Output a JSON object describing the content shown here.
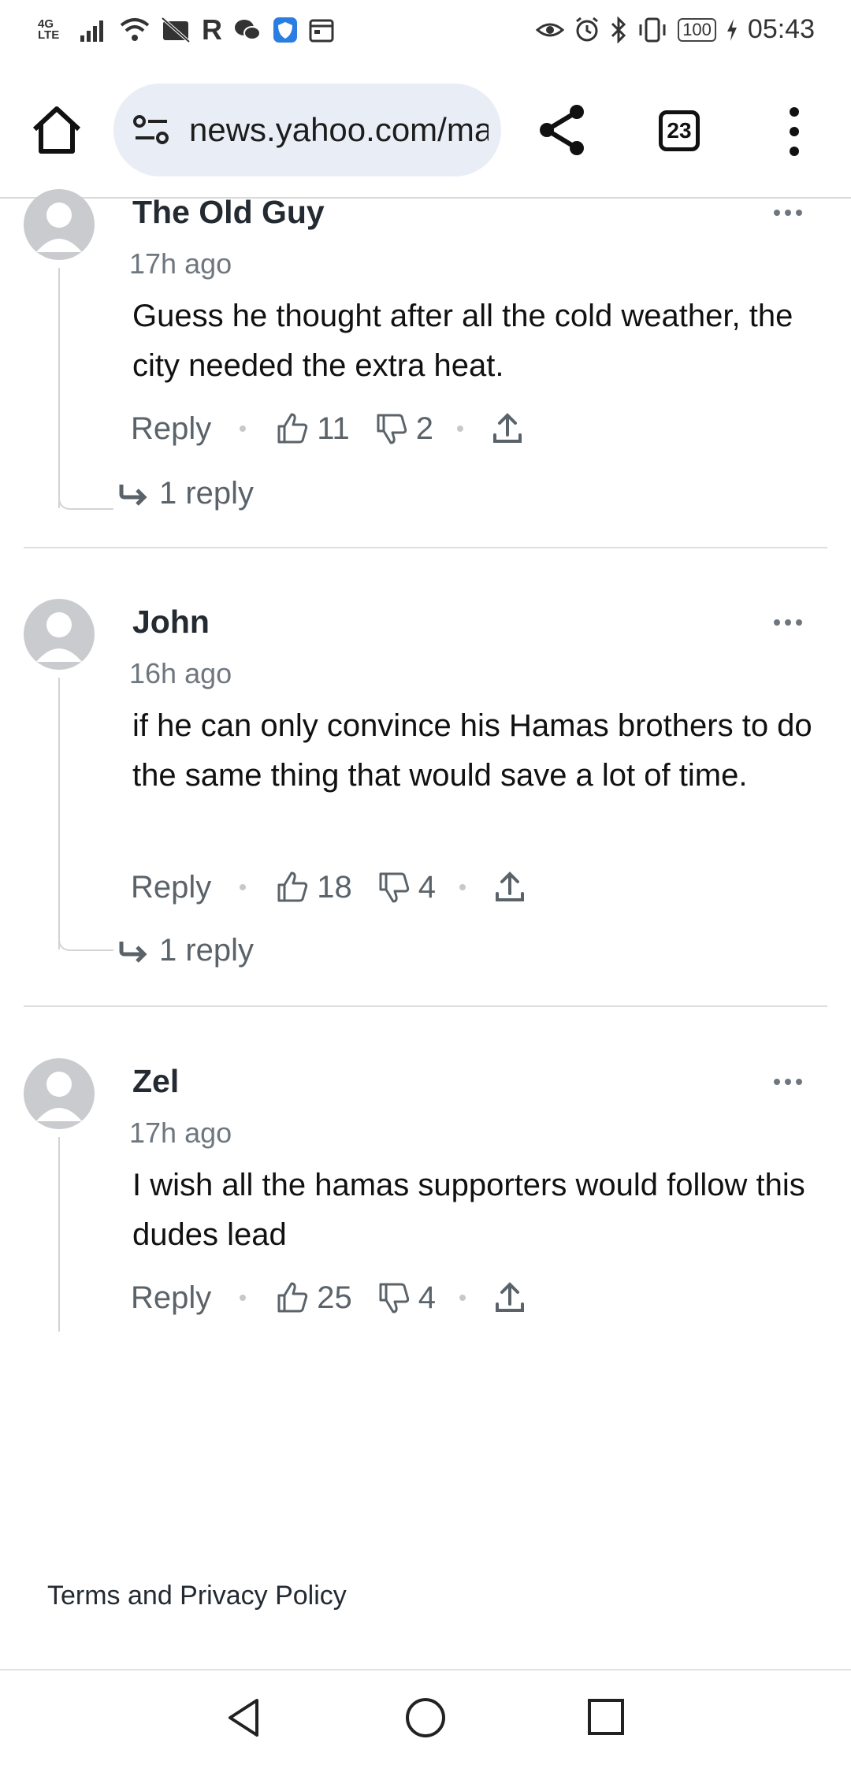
{
  "status_bar": {
    "network": "4G LTE",
    "battery": "100",
    "time": "05:43"
  },
  "browser": {
    "url": "news.yahoo.com/ma",
    "tab_count": "23",
    "icons": [
      "home-icon",
      "site-settings-icon",
      "share-icon",
      "tabs-icon",
      "more-vert-icon"
    ]
  },
  "comments": [
    {
      "author": "The Old Guy",
      "time": "17h ago",
      "text": "Guess he thought after all the cold weather, the city needed the extra heat.",
      "reply_label": "Reply",
      "likes": "11",
      "dislikes": "2",
      "replies": "1 reply"
    },
    {
      "author": "John",
      "time": "16h ago",
      "text": "if he can only convince his Hamas brothers to do the same thing that would save a lot of time.",
      "reply_label": "Reply",
      "likes": "18",
      "dislikes": "4",
      "replies": "1 reply"
    },
    {
      "author": "Zel",
      "time": "17h ago",
      "text": "I wish all the hamas supporters would follow this dudes lead",
      "reply_label": "Reply",
      "likes": "25",
      "dislikes": "4"
    }
  ],
  "footer": {
    "terms": "Terms and Privacy Policy"
  },
  "colors": {
    "url_pill": "#e9eef6",
    "avatar": "#c9cbcf",
    "muted_text": "#6e7780"
  }
}
